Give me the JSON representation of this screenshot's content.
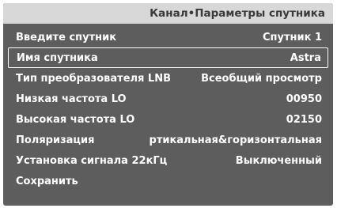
{
  "header": {
    "title": "Канал•Параметры спутника"
  },
  "menu": {
    "items": [
      {
        "label": "Введите спутник",
        "value": "Спутник 1",
        "selected": false
      },
      {
        "label": "Имя спутника",
        "value": "Astra",
        "selected": true
      },
      {
        "label": "Тип преобразователя LNB",
        "value": "Всеобщий просмотр",
        "selected": false
      },
      {
        "label": "Низкая частота LO",
        "value": "00950",
        "selected": false
      },
      {
        "label": "Высокая частота LO",
        "value": "02150",
        "selected": false
      },
      {
        "label": "Поляризация",
        "value": "ртикальная&горизонтальная",
        "selected": false
      },
      {
        "label": "Установка сигнала 22кГц",
        "value": "Выключенный",
        "selected": false
      },
      {
        "label": "Сохранить",
        "value": "",
        "selected": false
      }
    ]
  }
}
